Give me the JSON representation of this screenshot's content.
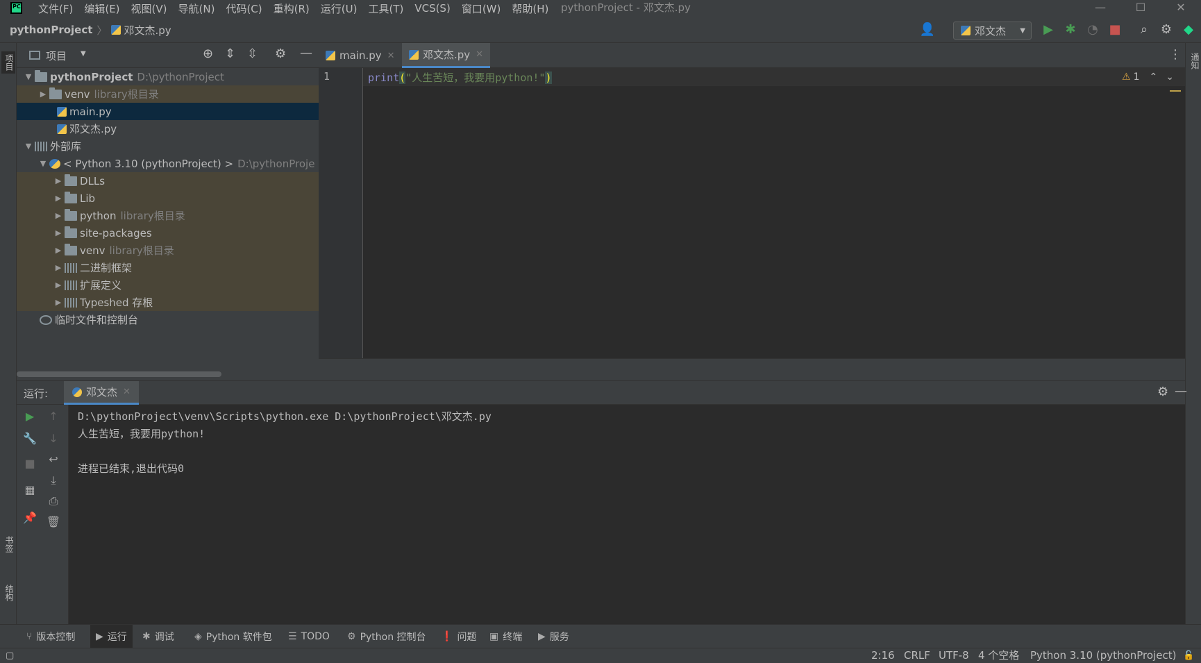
{
  "titlebar": {
    "menus": [
      "文件(F)",
      "编辑(E)",
      "视图(V)",
      "导航(N)",
      "代码(C)",
      "重构(R)",
      "运行(U)",
      "工具(T)",
      "VCS(S)",
      "窗口(W)",
      "帮助(H)"
    ],
    "window_title": "pythonProject - 邓文杰.py",
    "logo_text": "PC"
  },
  "navbar": {
    "project": "pythonProject",
    "file": "邓文杰.py",
    "run_config": "邓文杰"
  },
  "side_tabs": {
    "project": "项目",
    "bookmarks": "书签",
    "structure": "结构",
    "notifications": "通知"
  },
  "project_panel": {
    "title": "项目",
    "tree": [
      {
        "label": "pythonProject",
        "hint": "D:\\pythonProject"
      },
      {
        "label": "venv",
        "hint": "library根目录"
      },
      {
        "label": "main.py",
        "hint": ""
      },
      {
        "label": "邓文杰.py",
        "hint": ""
      },
      {
        "label": "外部库",
        "hint": ""
      },
      {
        "label": "< Python 3.10 (pythonProject) >",
        "hint": "D:\\pythonProje"
      },
      {
        "label": "DLLs",
        "hint": ""
      },
      {
        "label": "Lib",
        "hint": ""
      },
      {
        "label": "python",
        "hint": "library根目录"
      },
      {
        "label": "site-packages",
        "hint": ""
      },
      {
        "label": "venv",
        "hint": "library根目录"
      },
      {
        "label": "二进制框架",
        "hint": ""
      },
      {
        "label": "扩展定义",
        "hint": ""
      },
      {
        "label": "Typeshed 存根",
        "hint": ""
      },
      {
        "label": "临时文件和控制台",
        "hint": ""
      }
    ]
  },
  "editor": {
    "tabs": [
      "main.py",
      "邓文杰.py"
    ],
    "line_number": "1",
    "code_fn": "print",
    "code_open": "(",
    "code_str": "\"人生苦短，我要用python!\"",
    "code_close": ")",
    "inspection_count": "1"
  },
  "run_panel": {
    "label": "运行:",
    "tab": "邓文杰",
    "console": [
      "D:\\pythonProject\\venv\\Scripts\\python.exe D:\\pythonProject\\邓文杰.py",
      "人生苦短，我要用python!",
      "",
      "进程已结束,退出代码0"
    ]
  },
  "bottom_tools": [
    "版本控制",
    "运行",
    "调试",
    "Python 软件包",
    "TODO",
    "Python 控制台",
    "问题",
    "终端",
    "服务"
  ],
  "statusbar": {
    "position": "2:16",
    "line_sep": "CRLF",
    "encoding": "UTF-8",
    "indent": "4 个空格",
    "interpreter": "Python 3.10 (pythonProject)"
  },
  "colors": {
    "accent": "#4a88c7",
    "selected_row": "#0d293e",
    "library_row": "#4a4537",
    "run_green": "#499c54",
    "stop_red": "#c75450"
  }
}
